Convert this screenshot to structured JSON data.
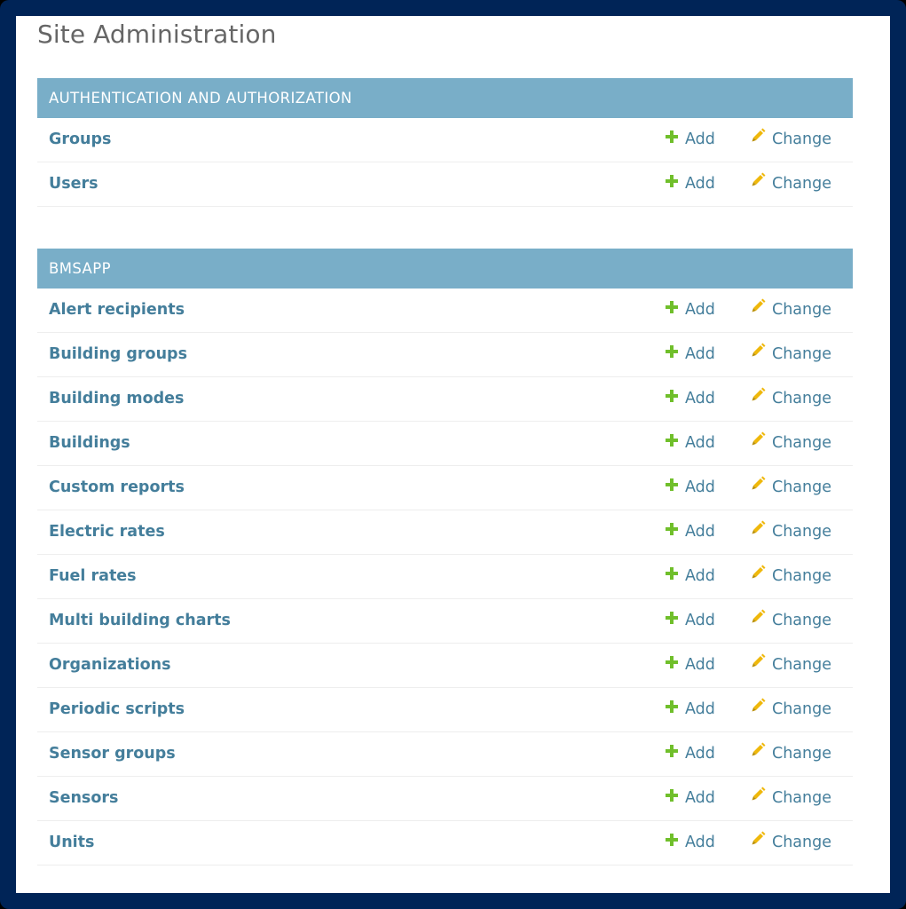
{
  "page": {
    "title": "Site Administration"
  },
  "colors": {
    "frame": "#002457",
    "caption_bg": "#79aec8",
    "link": "#447e9b",
    "add_icon": "#70bf2b",
    "change_icon": "#efb80b"
  },
  "actions": {
    "add": "Add",
    "change": "Change"
  },
  "modules": [
    {
      "caption": "AUTHENTICATION AND AUTHORIZATION",
      "models": [
        "Groups",
        "Users"
      ]
    },
    {
      "caption": "BMSAPP",
      "models": [
        "Alert recipients",
        "Building groups",
        "Building modes",
        "Buildings",
        "Custom reports",
        "Electric rates",
        "Fuel rates",
        "Multi building charts",
        "Organizations",
        "Periodic scripts",
        "Sensor groups",
        "Sensors",
        "Units"
      ]
    }
  ]
}
